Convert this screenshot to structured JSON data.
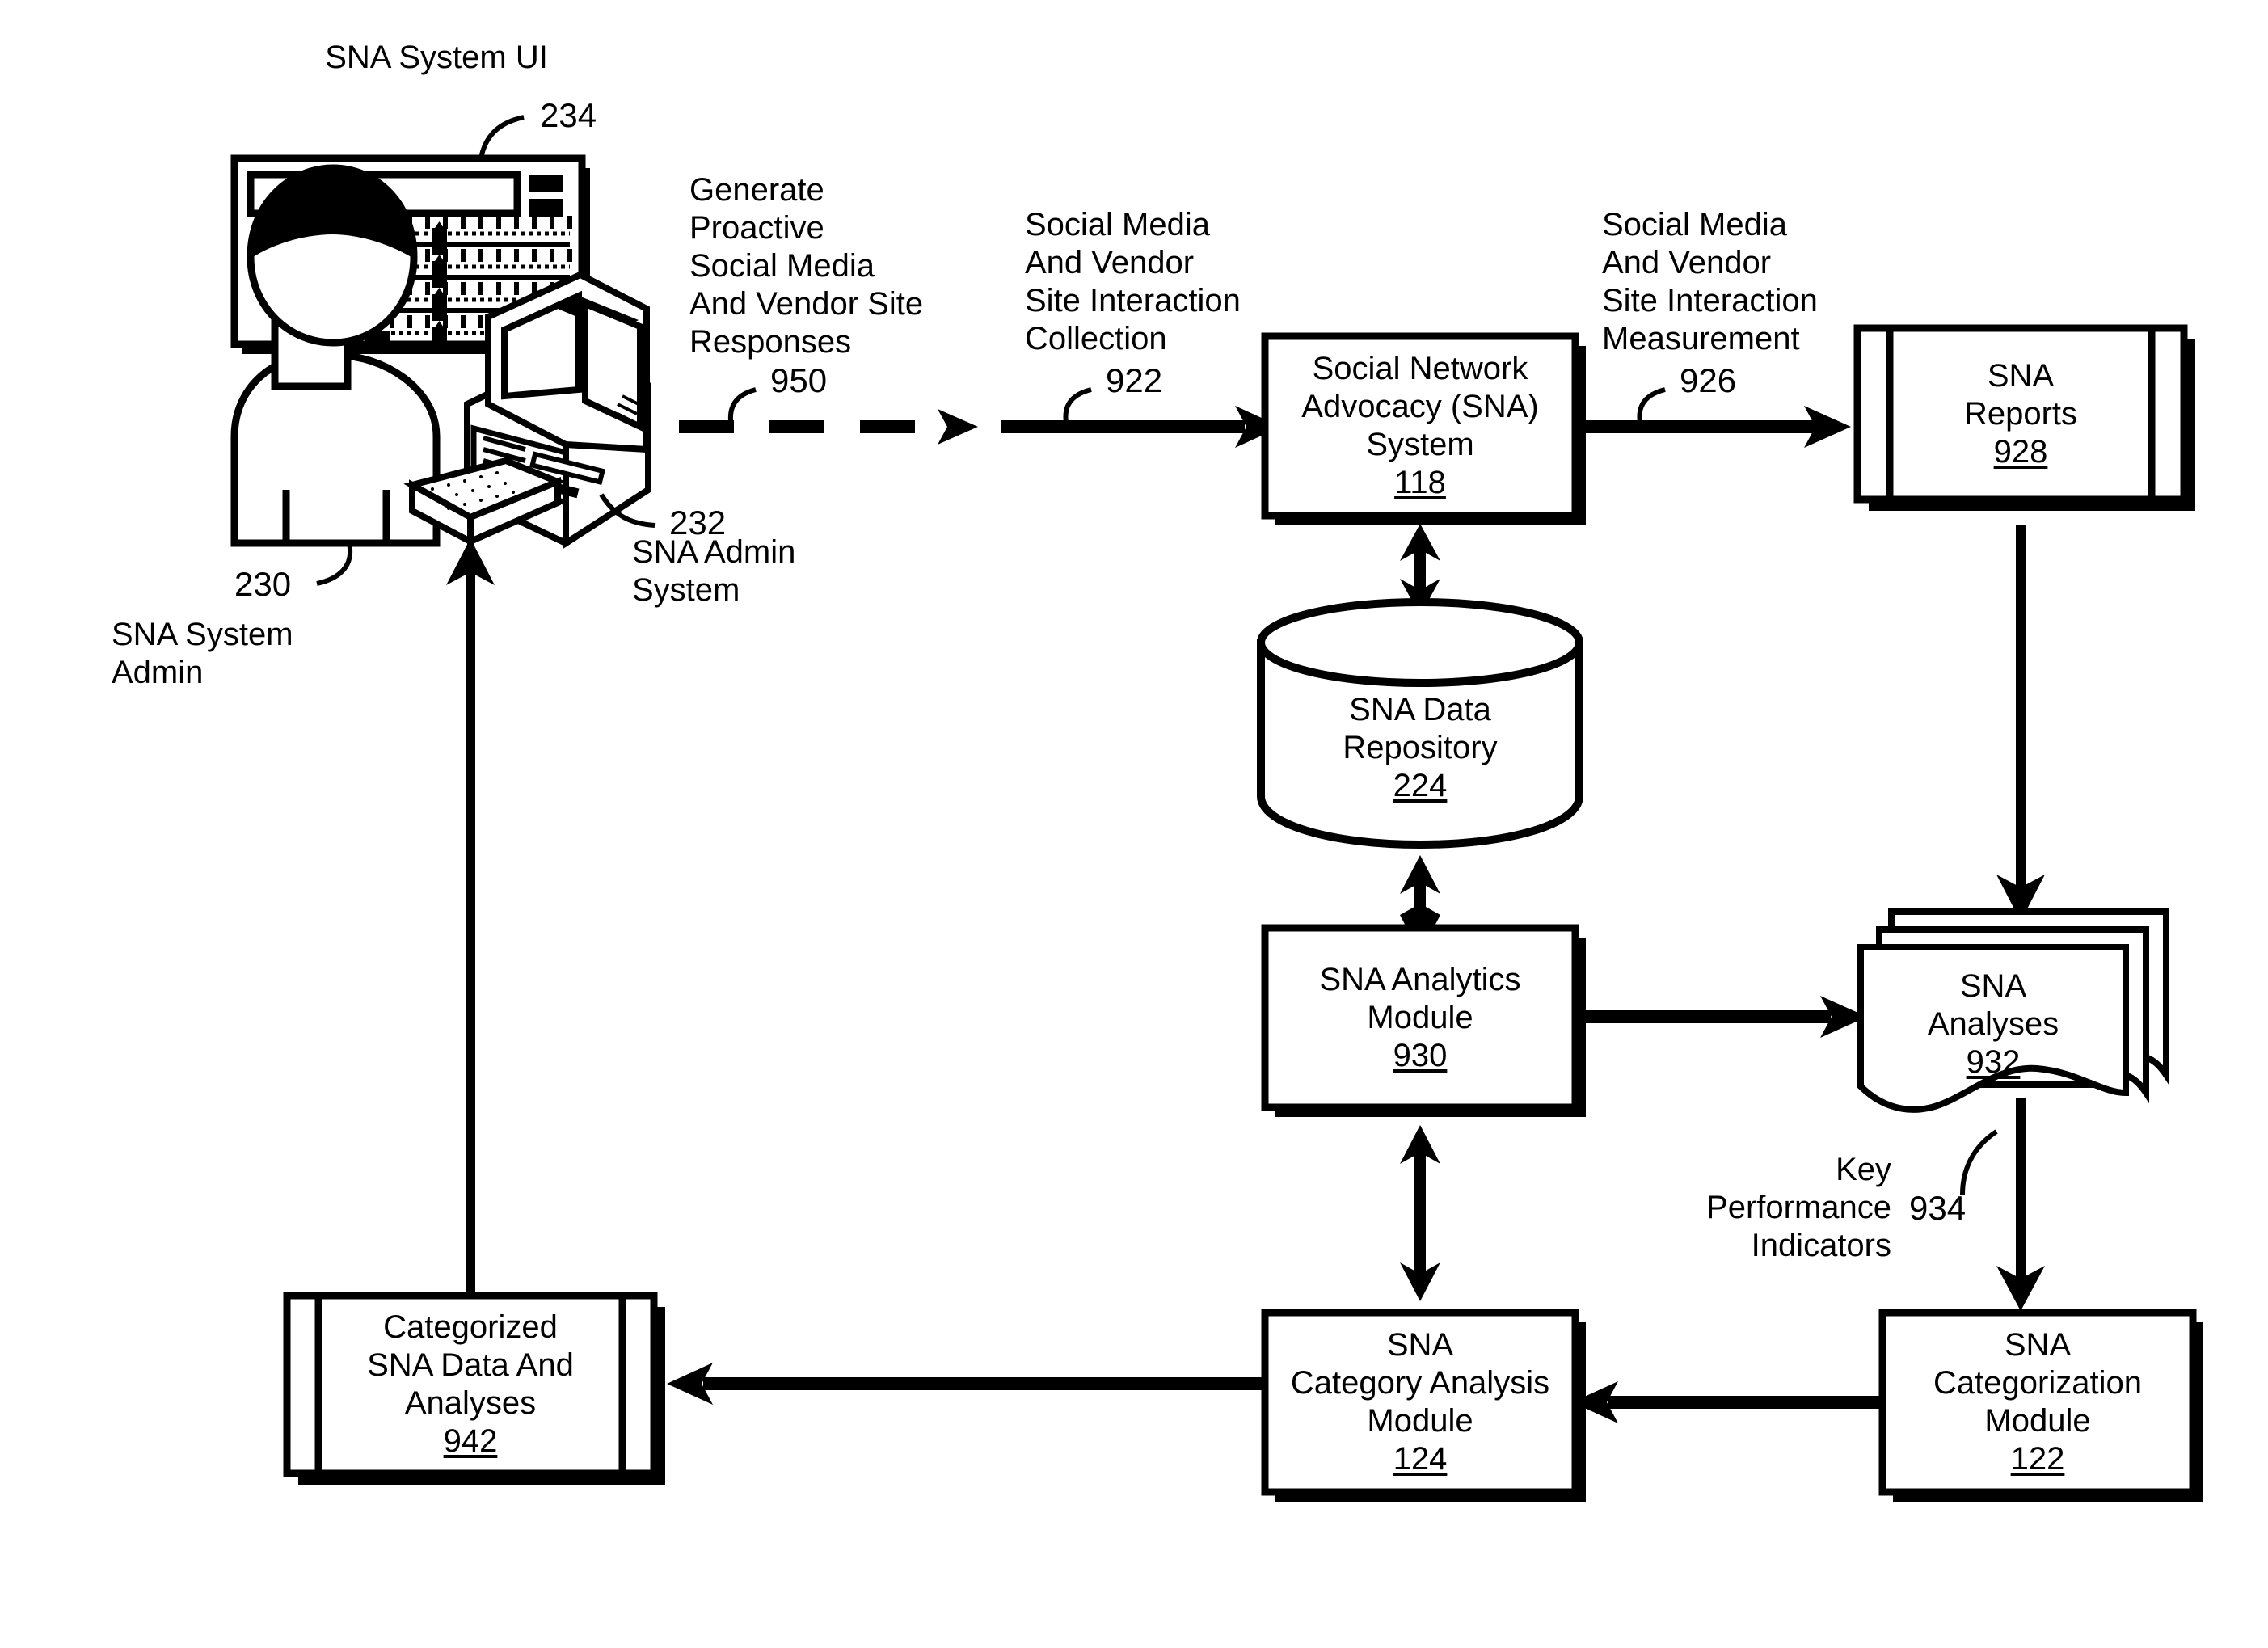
{
  "figure": {
    "type": "patent-block-diagram",
    "title_label": "SNA System UI",
    "background": "#ffffff",
    "ink": "#000000"
  },
  "labels": {
    "sna_system_ui": "SNA System UI",
    "ref_234": "234",
    "ref_232": "232",
    "sna_admin_system": "SNA Admin\nSystem",
    "ref_230": "230",
    "sna_system_admin": "SNA System\nAdmin",
    "generate_proactive": "Generate\nProactive\nSocial Media\nAnd Vendor Site\nResponses",
    "ref_950": "950",
    "interaction_collection": "Social Media\nAnd Vendor\nSite Interaction\nCollection",
    "ref_922": "922",
    "interaction_measurement": "Social Media\nAnd Vendor\nSite Interaction\nMeasurement",
    "ref_926": "926",
    "key_performance_indicators": "Key\nPerformance\nIndicators",
    "ref_934": "934"
  },
  "nodes": {
    "sna_system": {
      "name": "Social Network Advocacy (SNA) System",
      "lines": [
        "Social Network",
        "Advocacy (SNA)",
        "System"
      ],
      "ref": "118",
      "shape": "process-box"
    },
    "sna_reports": {
      "name": "SNA Reports",
      "lines": [
        "SNA",
        "Reports"
      ],
      "ref": "928",
      "shape": "stored-data-box"
    },
    "sna_data_repository": {
      "name": "SNA Data Repository",
      "lines": [
        "SNA Data",
        "Repository"
      ],
      "ref": "224",
      "shape": "cylinder"
    },
    "sna_analytics_module": {
      "name": "SNA Analytics Module",
      "lines": [
        "SNA Analytics",
        "Module"
      ],
      "ref": "930",
      "shape": "process-box"
    },
    "sna_analyses": {
      "name": "SNA Analyses",
      "lines": [
        "SNA",
        "Analyses"
      ],
      "ref": "932",
      "shape": "document-stack"
    },
    "sna_category_analysis_module": {
      "name": "SNA Category Analysis Module",
      "lines": [
        "SNA",
        "Category Analysis",
        "Module"
      ],
      "ref": "124",
      "shape": "process-box"
    },
    "sna_categorization_module": {
      "name": "SNA Categorization Module",
      "lines": [
        "SNA",
        "Categorization",
        "Module"
      ],
      "ref": "122",
      "shape": "process-box"
    },
    "categorized_sna_data": {
      "name": "Categorized SNA Data And Analyses",
      "lines": [
        "Categorized",
        "SNA Data And",
        "Analyses"
      ],
      "ref": "942",
      "shape": "stored-data-box"
    }
  },
  "illustrations": {
    "sna_system_ui_monitor": "monitor-with-dashboard",
    "sna_admin_system_computer": "desktop-computer",
    "sna_system_admin_person": "person-silhouette"
  },
  "connectors": [
    {
      "from": "sna_admin_system",
      "to": "sna_system",
      "style": "dashed-then-solid",
      "label": "Generate Proactive Social Media And Vendor Site Responses / Social Media And Vendor Site Interaction Collection"
    },
    {
      "from": "sna_system",
      "to": "sna_reports",
      "style": "solid",
      "label": "Social Media And Vendor Site Interaction Measurement"
    },
    {
      "from": "sna_system",
      "to": "sna_data_repository",
      "style": "double-headed"
    },
    {
      "from": "sna_data_repository",
      "to": "sna_analytics_module",
      "style": "double-headed"
    },
    {
      "from": "sna_analytics_module",
      "to": "sna_analyses",
      "style": "solid"
    },
    {
      "from": "sna_reports",
      "to": "sna_analyses",
      "style": "solid"
    },
    {
      "from": "sna_analyses",
      "to": "sna_categorization_module",
      "style": "solid",
      "label": "Key Performance Indicators"
    },
    {
      "from": "sna_categorization_module",
      "to": "sna_category_analysis_module",
      "style": "solid"
    },
    {
      "from": "sna_category_analysis_module",
      "to": "sna_analytics_module",
      "style": "double-headed"
    },
    {
      "from": "sna_category_analysis_module",
      "to": "categorized_sna_data",
      "style": "solid"
    },
    {
      "from": "categorized_sna_data",
      "to": "sna_admin_system",
      "style": "solid"
    }
  ]
}
